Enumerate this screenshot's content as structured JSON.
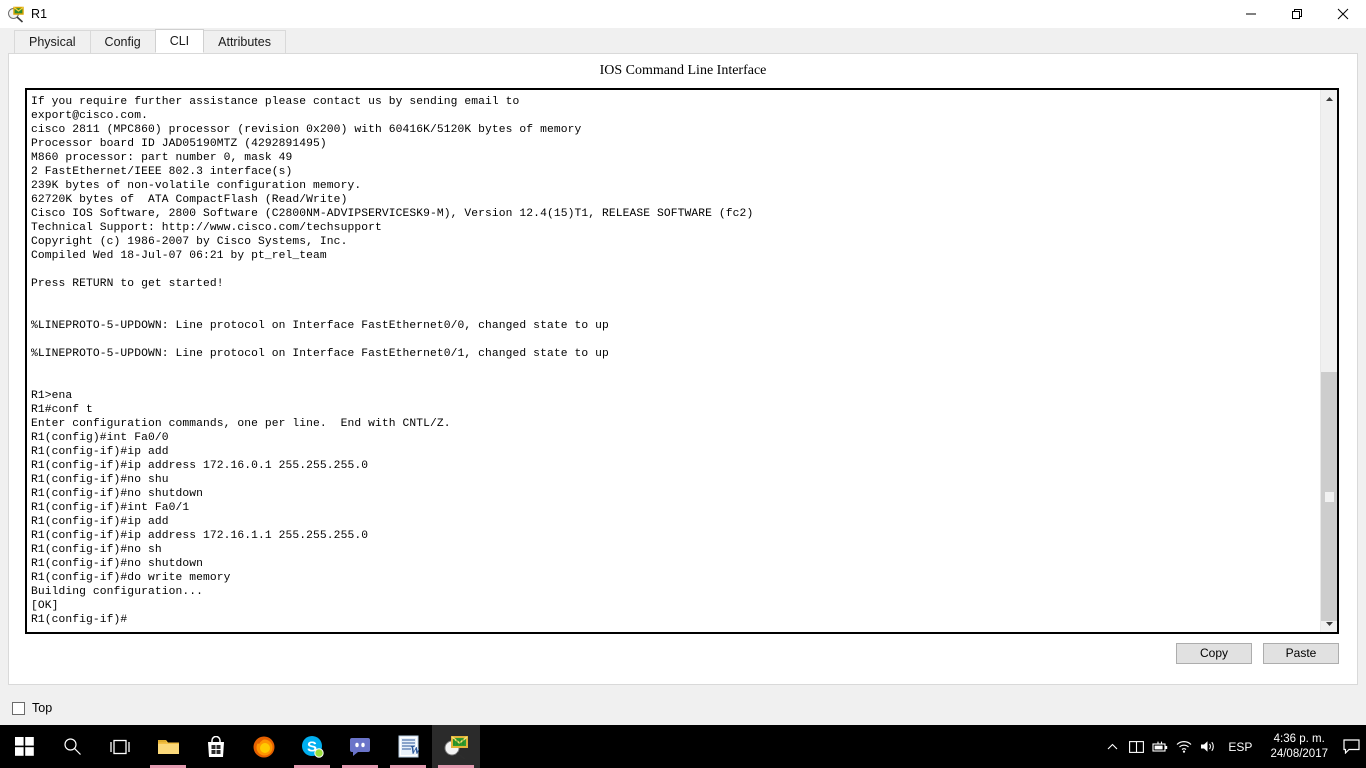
{
  "window": {
    "title": "R1",
    "icon": "packet-tracer-icon",
    "controls": {
      "minimize": "minimize-icon",
      "restore": "restore-icon",
      "close": "close-icon"
    }
  },
  "tabs": [
    {
      "label": "Physical",
      "active": false
    },
    {
      "label": "Config",
      "active": false
    },
    {
      "label": "CLI",
      "active": true
    },
    {
      "label": "Attributes",
      "active": false
    }
  ],
  "cli": {
    "header": "IOS Command Line Interface",
    "terminal_text": "If you require further assistance please contact us by sending email to\nexport@cisco.com.\ncisco 2811 (MPC860) processor (revision 0x200) with 60416K/5120K bytes of memory\nProcessor board ID JAD05190MTZ (4292891495)\nM860 processor: part number 0, mask 49\n2 FastEthernet/IEEE 802.3 interface(s)\n239K bytes of non-volatile configuration memory.\n62720K bytes of  ATA CompactFlash (Read/Write)\nCisco IOS Software, 2800 Software (C2800NM-ADVIPSERVICESK9-M), Version 12.4(15)T1, RELEASE SOFTWARE (fc2)\nTechnical Support: http://www.cisco.com/techsupport\nCopyright (c) 1986-2007 by Cisco Systems, Inc.\nCompiled Wed 18-Jul-07 06:21 by pt_rel_team\n\nPress RETURN to get started!\n\n\n%LINEPROTO-5-UPDOWN: Line protocol on Interface FastEthernet0/0, changed state to up\n\n%LINEPROTO-5-UPDOWN: Line protocol on Interface FastEthernet0/1, changed state to up\n\n\nR1>ena\nR1#conf t\nEnter configuration commands, one per line.  End with CNTL/Z.\nR1(config)#int Fa0/0\nR1(config-if)#ip add\nR1(config-if)#ip address 172.16.0.1 255.255.255.0\nR1(config-if)#no shu\nR1(config-if)#no shutdown\nR1(config-if)#int Fa0/1\nR1(config-if)#ip add\nR1(config-if)#ip address 172.16.1.1 255.255.255.0\nR1(config-if)#no sh\nR1(config-if)#no shutdown\nR1(config-if)#do write memory\nBuilding configuration...\n[OK]\nR1(config-if)#",
    "scroll_up_icon": "chevron-up-icon",
    "scroll_down_icon": "chevron-down-icon"
  },
  "actions": {
    "copy_label": "Copy",
    "paste_label": "Paste"
  },
  "footer": {
    "top_label": "Top",
    "top_checked": false
  },
  "taskbar": {
    "items": [
      {
        "name": "start-button",
        "icon": "windows-logo-icon",
        "active": false,
        "running": false
      },
      {
        "name": "search-button",
        "icon": "search-icon",
        "active": false,
        "running": false
      },
      {
        "name": "task-view-button",
        "icon": "task-view-icon",
        "active": false,
        "running": false
      },
      {
        "name": "file-explorer",
        "icon": "folder-icon",
        "active": false,
        "running": true
      },
      {
        "name": "microsoft-store",
        "icon": "store-bag-icon",
        "active": false,
        "running": false
      },
      {
        "name": "firefox",
        "icon": "firefox-icon",
        "active": false,
        "running": false
      },
      {
        "name": "skype",
        "icon": "skype-icon",
        "active": false,
        "running": true
      },
      {
        "name": "discord",
        "icon": "discord-icon",
        "active": false,
        "running": true
      },
      {
        "name": "word",
        "icon": "word-icon",
        "active": false,
        "running": true
      },
      {
        "name": "packet-tracer",
        "icon": "packet-tracer-icon",
        "active": true,
        "running": true
      }
    ],
    "tray": {
      "show_hidden_icon": "chevron-up-icon",
      "panel_icon": "panel-icon",
      "battery_icon": "battery-icon",
      "wifi_icon": "wifi-icon",
      "volume_icon": "speaker-icon",
      "language": "ESP",
      "time": "4:36 p. m.",
      "date": "24/08/2017",
      "notifications_icon": "notification-icon"
    }
  },
  "colors": {
    "window_bg": "#f0f0f0",
    "panel_bg": "#ffffff",
    "terminal_border": "#000000",
    "taskbar_bg": "#000000",
    "taskbar_underline": "#e49ab0",
    "button_bg": "#e1e1e1",
    "scrollbar_thumb": "#cdcdcd"
  }
}
